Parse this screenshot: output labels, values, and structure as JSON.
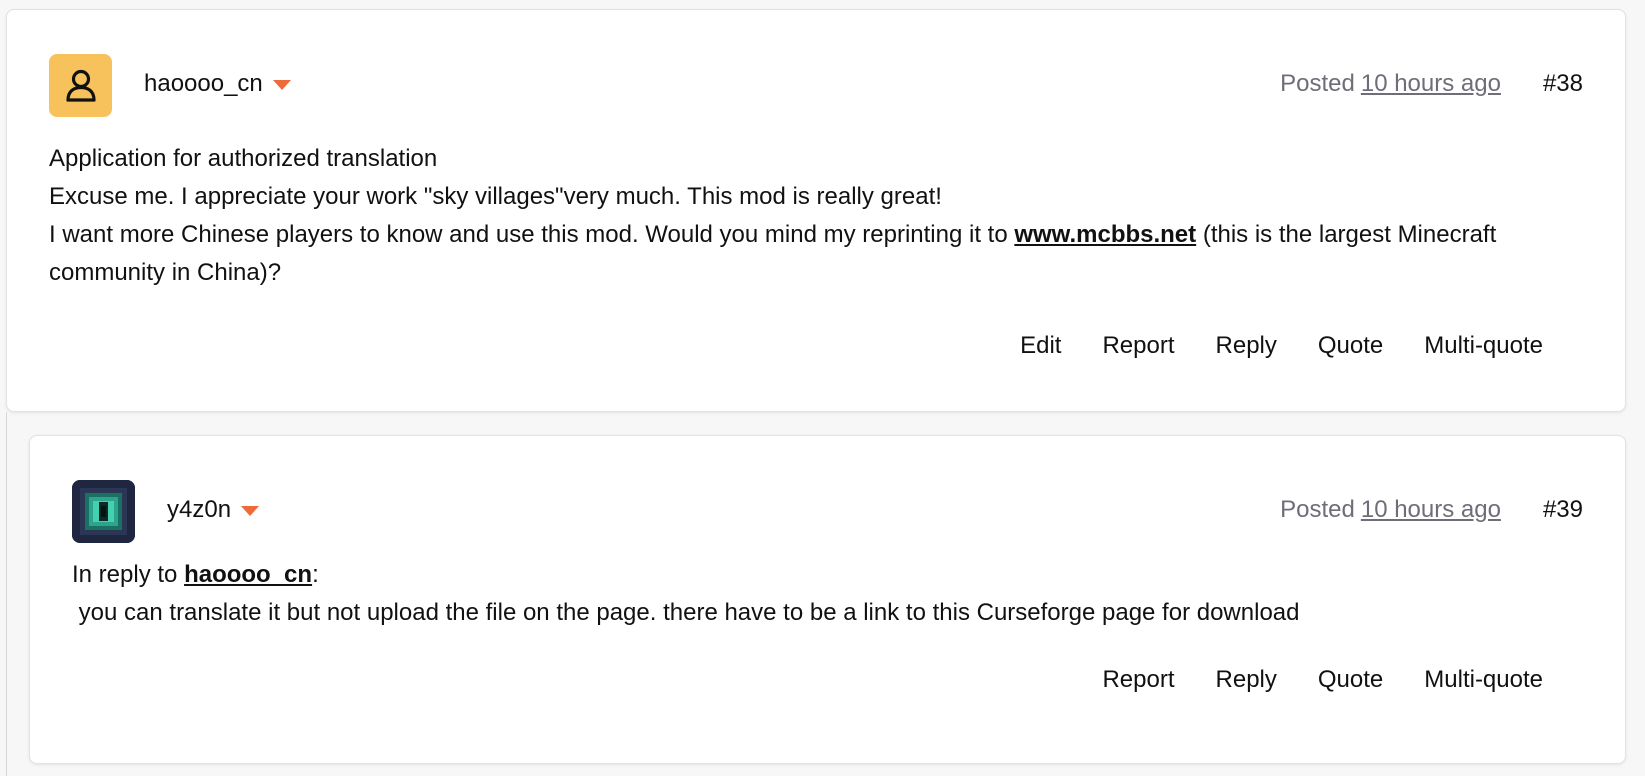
{
  "posts": [
    {
      "username": "haoooo_cn",
      "avatar_icon": "user-outline-icon",
      "avatar_color": "#f7c25b",
      "posted_label": "Posted",
      "posted_time": "10 hours ago",
      "post_number": "#38",
      "lines": [
        "Application for authorized translation",
        "Excuse me. I appreciate your work \"sky villages\"very much. This mod is really great!"
      ],
      "line3_before": "I want more Chinese players to know and use this mod. Would you mind my reprinting it to ",
      "line3_link": "www.mcbbs.net",
      "line3_after": " (this is the largest Minecraft community in China)?",
      "actions": [
        "Edit",
        "Report",
        "Reply",
        "Quote",
        "Multi-quote"
      ]
    },
    {
      "username": "y4z0n",
      "avatar_icon": "ender-eye-icon",
      "avatar_color": "#1f2740",
      "posted_label": "Posted",
      "posted_time": "10 hours ago",
      "post_number": "#39",
      "reply_prefix": "In reply to ",
      "reply_user": "haoooo_cn",
      "reply_suffix": ":",
      "text": " you can translate it but not upload the file on the page. there have to be a link to this Curseforge page for download",
      "actions": [
        "Report",
        "Reply",
        "Quote",
        "Multi-quote"
      ]
    }
  ],
  "colors": {
    "caret": "#ef6a3a",
    "muted_text": "#6e6e78"
  }
}
